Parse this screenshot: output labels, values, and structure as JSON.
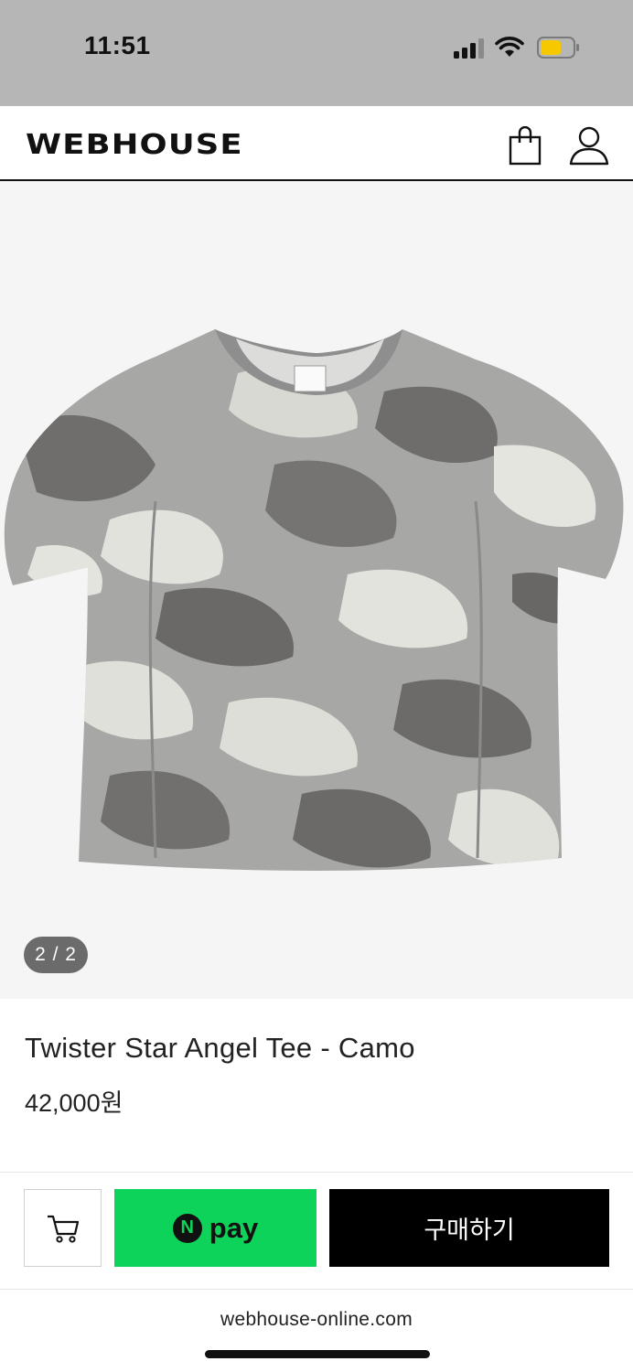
{
  "status_bar": {
    "time": "11:51",
    "signal_icon": "cellular-signal-icon",
    "wifi_icon": "wifi-icon",
    "battery_icon": "battery-icon",
    "battery_color": "#f6c800"
  },
  "header": {
    "logo": "WEBHOUSE",
    "bag_icon": "shopping-bag-icon",
    "user_icon": "user-icon"
  },
  "gallery": {
    "image_alt": "camo-tee-image",
    "counter": "2 / 2"
  },
  "product": {
    "name": "Twister Star Angel Tee - Camo",
    "price": "42,000원"
  },
  "actions": {
    "cart_icon": "cart-icon",
    "npay_badge": "N",
    "npay_label": "pay",
    "npay_color": "#0ed35a",
    "buy_label": "구매하기"
  },
  "browser": {
    "url": "webhouse-online.com"
  }
}
